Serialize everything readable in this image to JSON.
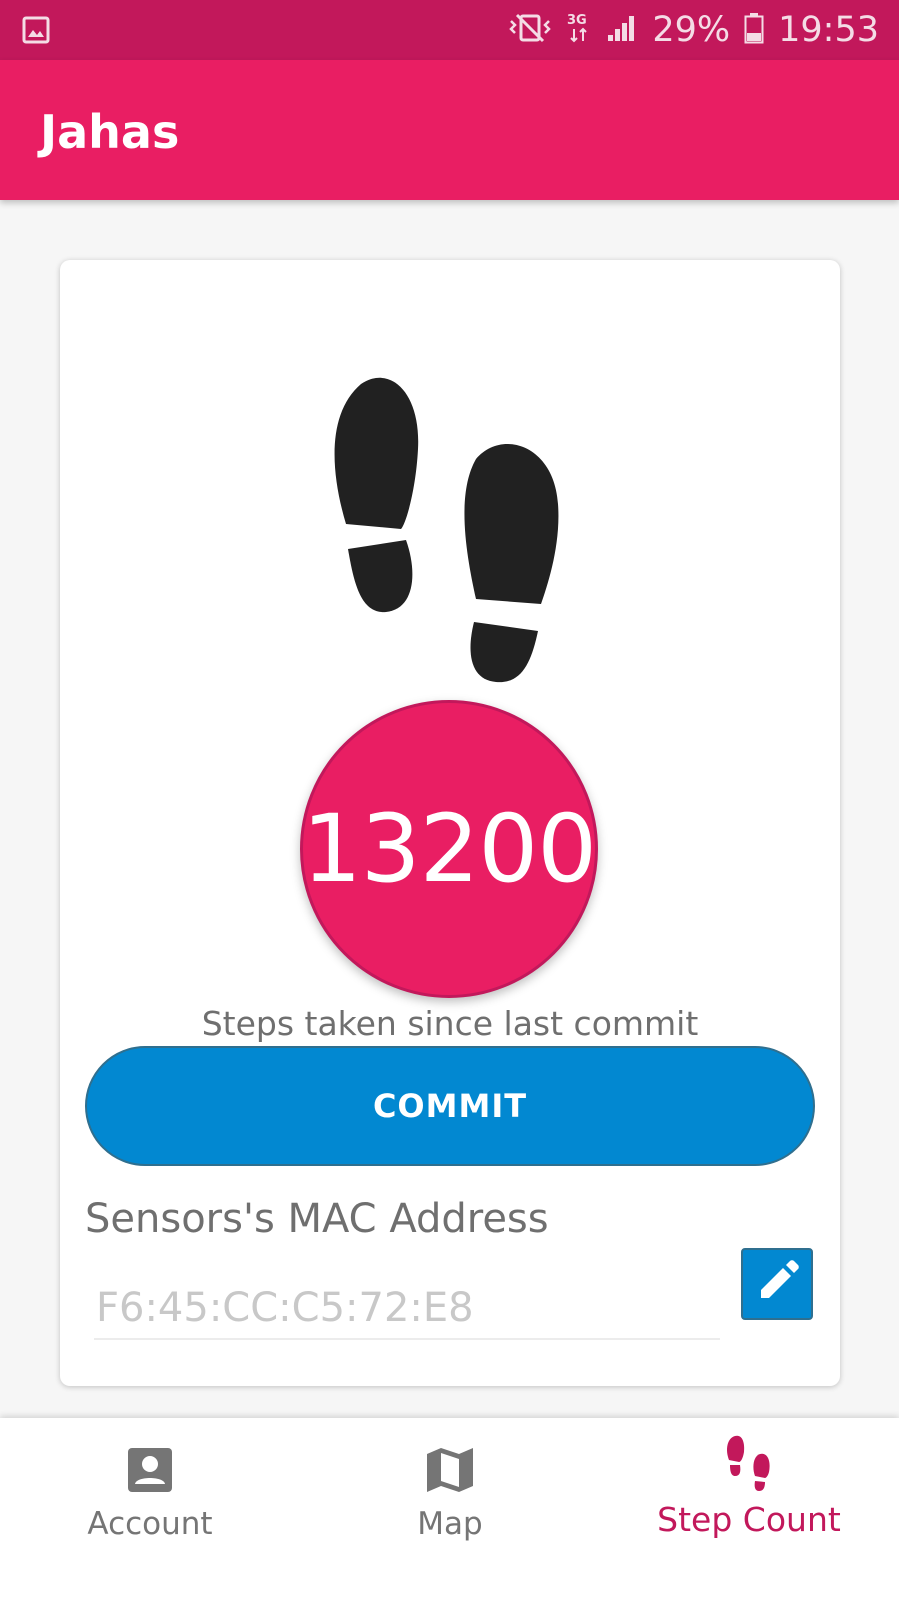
{
  "status_bar": {
    "battery_percent": "29%",
    "time": "19:53",
    "network": "3G",
    "icons": [
      "gallery-icon",
      "vibrate-icon",
      "network-3g-icon",
      "signal-icon",
      "battery-icon"
    ]
  },
  "app_bar": {
    "title": "Jahas"
  },
  "step_card": {
    "icon": "footprints-icon",
    "step_count": "13200",
    "caption": "Steps taken since last commit",
    "commit_label": "COMMIT",
    "mac_label": "Sensors's MAC Address",
    "mac_placeholder": "F6:45:CC:C5:72:E8",
    "edit_icon": "pencil-icon"
  },
  "bottom_nav": {
    "items": [
      {
        "label": "Account",
        "icon": "account-box-icon",
        "active": false
      },
      {
        "label": "Map",
        "icon": "map-icon",
        "active": false
      },
      {
        "label": "Step Count",
        "icon": "footprints-icon",
        "active": true
      }
    ]
  },
  "colors": {
    "primary": "#e91e63",
    "primary_dark": "#c2185b",
    "accent": "#0288d1",
    "background": "#f6f6f6",
    "card": "#ffffff",
    "text_secondary": "#6f6f6f"
  }
}
